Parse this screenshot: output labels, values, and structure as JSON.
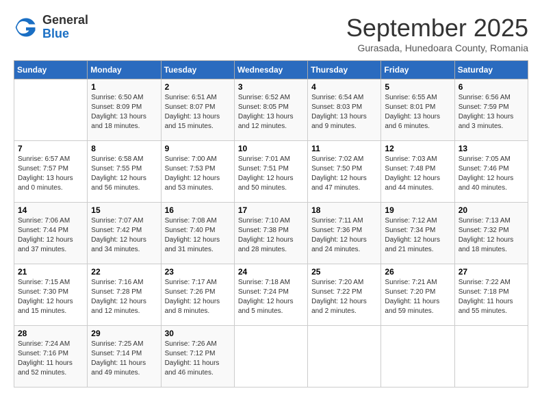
{
  "logo": {
    "general": "General",
    "blue": "Blue"
  },
  "title": "September 2025",
  "subtitle": "Gurasada, Hunedoara County, Romania",
  "days_of_week": [
    "Sunday",
    "Monday",
    "Tuesday",
    "Wednesday",
    "Thursday",
    "Friday",
    "Saturday"
  ],
  "weeks": [
    [
      {
        "day": "",
        "detail": ""
      },
      {
        "day": "1",
        "detail": "Sunrise: 6:50 AM\nSunset: 8:09 PM\nDaylight: 13 hours\nand 18 minutes."
      },
      {
        "day": "2",
        "detail": "Sunrise: 6:51 AM\nSunset: 8:07 PM\nDaylight: 13 hours\nand 15 minutes."
      },
      {
        "day": "3",
        "detail": "Sunrise: 6:52 AM\nSunset: 8:05 PM\nDaylight: 13 hours\nand 12 minutes."
      },
      {
        "day": "4",
        "detail": "Sunrise: 6:54 AM\nSunset: 8:03 PM\nDaylight: 13 hours\nand 9 minutes."
      },
      {
        "day": "5",
        "detail": "Sunrise: 6:55 AM\nSunset: 8:01 PM\nDaylight: 13 hours\nand 6 minutes."
      },
      {
        "day": "6",
        "detail": "Sunrise: 6:56 AM\nSunset: 7:59 PM\nDaylight: 13 hours\nand 3 minutes."
      }
    ],
    [
      {
        "day": "7",
        "detail": "Sunrise: 6:57 AM\nSunset: 7:57 PM\nDaylight: 13 hours\nand 0 minutes."
      },
      {
        "day": "8",
        "detail": "Sunrise: 6:58 AM\nSunset: 7:55 PM\nDaylight: 12 hours\nand 56 minutes."
      },
      {
        "day": "9",
        "detail": "Sunrise: 7:00 AM\nSunset: 7:53 PM\nDaylight: 12 hours\nand 53 minutes."
      },
      {
        "day": "10",
        "detail": "Sunrise: 7:01 AM\nSunset: 7:51 PM\nDaylight: 12 hours\nand 50 minutes."
      },
      {
        "day": "11",
        "detail": "Sunrise: 7:02 AM\nSunset: 7:50 PM\nDaylight: 12 hours\nand 47 minutes."
      },
      {
        "day": "12",
        "detail": "Sunrise: 7:03 AM\nSunset: 7:48 PM\nDaylight: 12 hours\nand 44 minutes."
      },
      {
        "day": "13",
        "detail": "Sunrise: 7:05 AM\nSunset: 7:46 PM\nDaylight: 12 hours\nand 40 minutes."
      }
    ],
    [
      {
        "day": "14",
        "detail": "Sunrise: 7:06 AM\nSunset: 7:44 PM\nDaylight: 12 hours\nand 37 minutes."
      },
      {
        "day": "15",
        "detail": "Sunrise: 7:07 AM\nSunset: 7:42 PM\nDaylight: 12 hours\nand 34 minutes."
      },
      {
        "day": "16",
        "detail": "Sunrise: 7:08 AM\nSunset: 7:40 PM\nDaylight: 12 hours\nand 31 minutes."
      },
      {
        "day": "17",
        "detail": "Sunrise: 7:10 AM\nSunset: 7:38 PM\nDaylight: 12 hours\nand 28 minutes."
      },
      {
        "day": "18",
        "detail": "Sunrise: 7:11 AM\nSunset: 7:36 PM\nDaylight: 12 hours\nand 24 minutes."
      },
      {
        "day": "19",
        "detail": "Sunrise: 7:12 AM\nSunset: 7:34 PM\nDaylight: 12 hours\nand 21 minutes."
      },
      {
        "day": "20",
        "detail": "Sunrise: 7:13 AM\nSunset: 7:32 PM\nDaylight: 12 hours\nand 18 minutes."
      }
    ],
    [
      {
        "day": "21",
        "detail": "Sunrise: 7:15 AM\nSunset: 7:30 PM\nDaylight: 12 hours\nand 15 minutes."
      },
      {
        "day": "22",
        "detail": "Sunrise: 7:16 AM\nSunset: 7:28 PM\nDaylight: 12 hours\nand 12 minutes."
      },
      {
        "day": "23",
        "detail": "Sunrise: 7:17 AM\nSunset: 7:26 PM\nDaylight: 12 hours\nand 8 minutes."
      },
      {
        "day": "24",
        "detail": "Sunrise: 7:18 AM\nSunset: 7:24 PM\nDaylight: 12 hours\nand 5 minutes."
      },
      {
        "day": "25",
        "detail": "Sunrise: 7:20 AM\nSunset: 7:22 PM\nDaylight: 12 hours\nand 2 minutes."
      },
      {
        "day": "26",
        "detail": "Sunrise: 7:21 AM\nSunset: 7:20 PM\nDaylight: 11 hours\nand 59 minutes."
      },
      {
        "day": "27",
        "detail": "Sunrise: 7:22 AM\nSunset: 7:18 PM\nDaylight: 11 hours\nand 55 minutes."
      }
    ],
    [
      {
        "day": "28",
        "detail": "Sunrise: 7:24 AM\nSunset: 7:16 PM\nDaylight: 11 hours\nand 52 minutes."
      },
      {
        "day": "29",
        "detail": "Sunrise: 7:25 AM\nSunset: 7:14 PM\nDaylight: 11 hours\nand 49 minutes."
      },
      {
        "day": "30",
        "detail": "Sunrise: 7:26 AM\nSunset: 7:12 PM\nDaylight: 11 hours\nand 46 minutes."
      },
      {
        "day": "",
        "detail": ""
      },
      {
        "day": "",
        "detail": ""
      },
      {
        "day": "",
        "detail": ""
      },
      {
        "day": "",
        "detail": ""
      }
    ]
  ]
}
